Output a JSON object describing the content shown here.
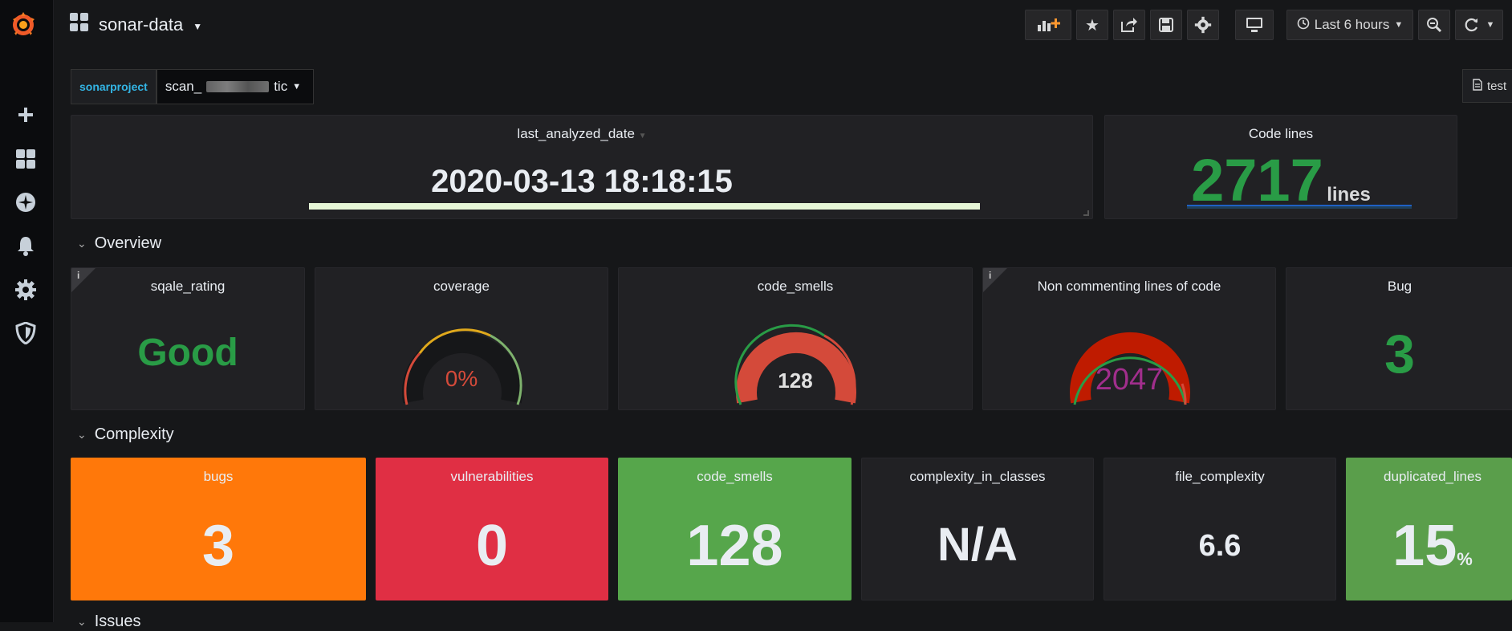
{
  "dashboard": {
    "title": "sonar-data"
  },
  "topbar": {
    "timepicker_label": "Last 6 hours"
  },
  "variable": {
    "label": "sonarproject",
    "value_prefix": "scan_",
    "value_suffix": "tic"
  },
  "dashlink": {
    "label": "test"
  },
  "panels": {
    "last_analyzed": {
      "title": "last_analyzed_date",
      "value": "2020-03-13 18:18:15"
    },
    "code_lines": {
      "title": "Code lines",
      "value": "2717",
      "unit": "lines",
      "color": "#299c46"
    }
  },
  "rows": {
    "overview": "Overview",
    "complexity": "Complexity",
    "issues": "Issues"
  },
  "overview": {
    "sqale_rating": {
      "title": "sqale_rating",
      "value": "Good",
      "color": "#299c46"
    },
    "coverage": {
      "title": "coverage",
      "value": "0%",
      "level": 0,
      "color": "#d44a3a"
    },
    "code_smells": {
      "title": "code_smells",
      "value": "128",
      "color": "#e0e0e0"
    },
    "ncloc": {
      "title": "Non commenting lines of code",
      "value": "2047",
      "color": "#a12e8c"
    },
    "bug": {
      "title": "Bug",
      "value": "3",
      "color": "#299c46"
    }
  },
  "complexity": [
    {
      "title": "bugs",
      "value": "3",
      "unit": "",
      "bg": "#ff780a"
    },
    {
      "title": "vulnerabilities",
      "value": "0",
      "unit": "",
      "bg": "#e02f44"
    },
    {
      "title": "code_smells",
      "value": "128",
      "unit": "",
      "bg": "#56a64b"
    },
    {
      "title": "complexity_in_classes",
      "value": "N/A",
      "unit": "",
      "bg": "#212124"
    },
    {
      "title": "file_complexity",
      "value": "6.6",
      "unit": "",
      "bg": "#212124"
    },
    {
      "title": "duplicated_lines",
      "value": "15",
      "unit": "%",
      "bg": "#5a9e4b"
    }
  ]
}
